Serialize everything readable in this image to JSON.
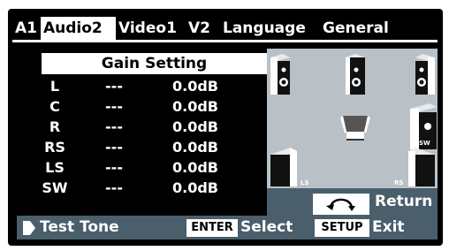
{
  "tabs": [
    "A1",
    "Audio2",
    "Video1",
    "V2",
    "Language",
    "General"
  ],
  "active_tab": 1,
  "gain": {
    "header": "Gain Setting",
    "rows": [
      {
        "channel": "L",
        "dash": "---",
        "value": "0.0dB"
      },
      {
        "channel": "C",
        "dash": "---",
        "value": "0.0dB"
      },
      {
        "channel": "R",
        "dash": "---",
        "value": "0.0dB"
      },
      {
        "channel": "RS",
        "dash": "---",
        "value": "0.0dB"
      },
      {
        "channel": "LS",
        "dash": "---",
        "value": "0.0dB"
      },
      {
        "channel": "SW",
        "dash": "---",
        "value": "0.0dB"
      }
    ]
  },
  "speakers": {
    "ls_label": "LS",
    "rs_label": "RS",
    "sw_label": "SW"
  },
  "footer": {
    "test_tone": "Test Tone",
    "enter_key": "ENTER",
    "select_label": "Select",
    "setup_key": "SETUP",
    "exit_label": "Exit",
    "return_label": "Return"
  },
  "colors": {
    "panel_gray": "#b9c1c7",
    "bar_blue_gray": "#4a5e6b"
  }
}
